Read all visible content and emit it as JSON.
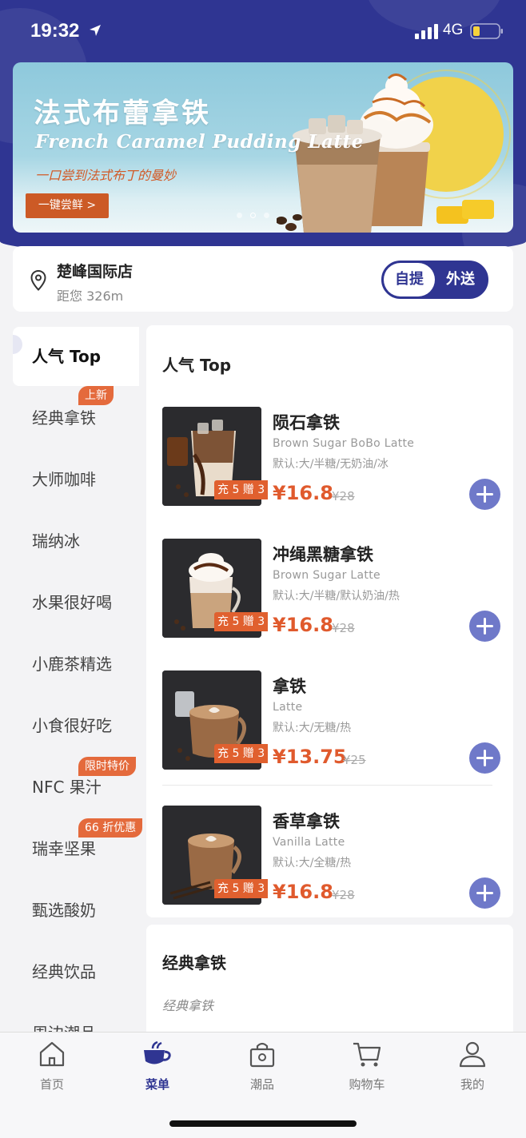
{
  "status_bar": {
    "time": "19:32",
    "network": "4G"
  },
  "banner": {
    "title": "法式布蕾拿铁",
    "subtitle": "French Caramel Pudding Latte",
    "tagline": "一口尝到法式布丁的曼妙",
    "cta": "一键尝鲜 >"
  },
  "store": {
    "name": "楚峰国际店",
    "distance": "距您 326m",
    "mode_selected": "自提",
    "mode_other": "外送"
  },
  "sidebar": {
    "items": [
      {
        "label": "人气 Top",
        "badge": ""
      },
      {
        "label": "经典拿铁",
        "badge": "上新"
      },
      {
        "label": "大师咖啡",
        "badge": ""
      },
      {
        "label": "瑞纳冰",
        "badge": ""
      },
      {
        "label": "水果很好喝",
        "badge": ""
      },
      {
        "label": "小鹿茶精选",
        "badge": ""
      },
      {
        "label": "小食很好吃",
        "badge": ""
      },
      {
        "label": "NFC 果汁",
        "badge": "限时特价"
      },
      {
        "label": "瑞幸坚果",
        "badge": "66 折优惠"
      },
      {
        "label": "甄选酸奶",
        "badge": ""
      },
      {
        "label": "经典饮品",
        "badge": ""
      },
      {
        "label": "周边潮品",
        "badge": ""
      }
    ]
  },
  "section_top": {
    "title": "人气 Top",
    "products": [
      {
        "name": "陨石拿铁",
        "en": "Brown Sugar BoBo Latte",
        "options": "默认:大/半糖/无奶油/冰",
        "price": "¥16.8",
        "old_price": "¥28",
        "promo": "充 5 赠 3"
      },
      {
        "name": "冲绳黑糖拿铁",
        "en": "Brown Sugar Latte",
        "options": "默认:大/半糖/默认奶油/热",
        "price": "¥16.8",
        "old_price": "¥28",
        "promo": "充 5 赠 3"
      },
      {
        "name": "拿铁",
        "en": "Latte",
        "options": "默认:大/无糖/热",
        "price": "¥13.75",
        "old_price": "¥25",
        "promo": "充 5 赠 3"
      },
      {
        "name": "香草拿铁",
        "en": "Vanilla Latte",
        "options": "默认:大/全糖/热",
        "price": "¥16.8",
        "old_price": "¥28",
        "promo": "充 5 赠 3"
      }
    ]
  },
  "section_classic": {
    "title": "经典拿铁",
    "subtitle": "经典拿铁"
  },
  "tabbar": {
    "tabs": [
      {
        "label": "首页",
        "icon": "home-icon"
      },
      {
        "label": "菜单",
        "icon": "coffee-cup-icon"
      },
      {
        "label": "潮品",
        "icon": "shopping-bag-icon"
      },
      {
        "label": "购物车",
        "icon": "cart-icon"
      },
      {
        "label": "我的",
        "icon": "user-icon"
      }
    ],
    "active": "菜单"
  },
  "colors": {
    "brand": "#2f3592",
    "accent": "#e05a2d",
    "add_button": "#6f79c9"
  }
}
